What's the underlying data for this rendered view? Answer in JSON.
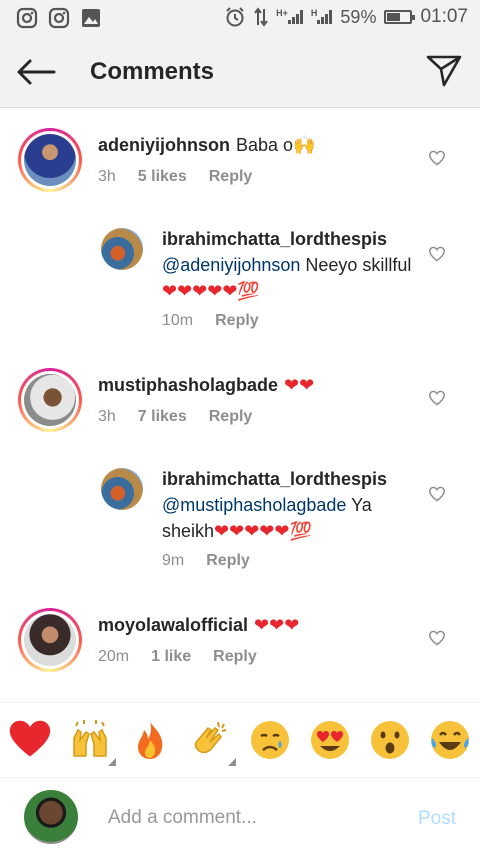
{
  "status_bar": {
    "battery": "59%",
    "time": "01:07",
    "network": "H+",
    "battery_level": 0.59
  },
  "header": {
    "title": "Comments"
  },
  "comments": [
    {
      "username": "adeniyijohnson",
      "text": "Baba o",
      "emoji_suffix": "🙌",
      "time": "3h",
      "likes": "5 likes",
      "reply": "Reply"
    },
    {
      "username": "ibrahimchatta_lordthespis",
      "mention": "@adeniyijohnson",
      "text": "Neeyo skillful",
      "emoji_suffix": "❤❤❤❤❤💯",
      "time": "10m",
      "reply": "Reply"
    },
    {
      "username": "mustiphasholagbade",
      "text": "",
      "emoji_suffix": "❤❤",
      "time": "3h",
      "likes": "7 likes",
      "reply": "Reply"
    },
    {
      "username": "ibrahimchatta_lordthespis",
      "mention": "@mustiphasholagbade",
      "text": "Ya sheikh",
      "emoji_suffix": "❤❤❤❤❤💯",
      "time": "9m",
      "reply": "Reply"
    },
    {
      "username": "moyolawalofficial",
      "text": "",
      "emoji_suffix": "❤❤❤",
      "time": "20m",
      "likes": "1 like",
      "reply": "Reply"
    }
  ],
  "emoji_bar": [
    "❤",
    "🙌",
    "🔥",
    "👏",
    "😢",
    "😍",
    "😮",
    "😂"
  ],
  "input": {
    "placeholder": "Add a comment...",
    "post_label": "Post"
  },
  "colors": {
    "heart": "#e8262d",
    "mention": "#00376b",
    "post_disabled": "#b3dbff"
  }
}
